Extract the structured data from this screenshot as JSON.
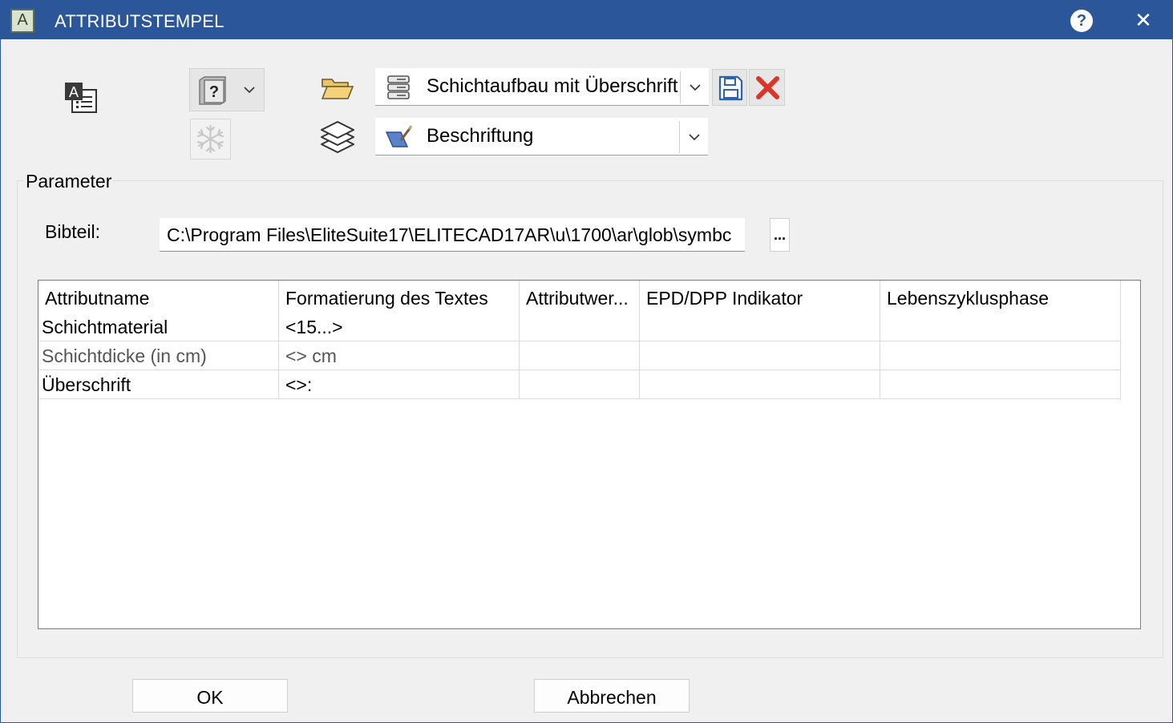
{
  "window": {
    "title": "ATTRIBUTSTEMPEL",
    "app_icon_letter": "A",
    "help_symbol": "?",
    "close_symbol": "✕",
    "titlebar_color": "#2b579a"
  },
  "toolbar": {
    "book_icon_glyph": "?",
    "preset_combo": {
      "value": "Schichtaufbau mit Überschrift"
    },
    "layer_combo": {
      "value": "Beschriftung"
    }
  },
  "parameter": {
    "group_label": "Parameter",
    "bibteil_label": "Bibteil:",
    "bibteil_value": "C:\\Program Files\\EliteSuite17\\ELITECAD17AR\\u\\1700\\ar\\glob\\symbc",
    "browse_label": "..."
  },
  "table": {
    "columns": [
      "Attributname",
      "Formatierung des Textes",
      "Attributwer...",
      "EPD/DPP Indikator",
      "Lebenszyklusphase"
    ],
    "rows": [
      [
        "Schichtmaterial",
        "<15...>",
        "",
        "",
        ""
      ],
      [
        "Schichtdicke (in cm)",
        "<> cm",
        "",
        "",
        ""
      ],
      [
        "Überschrift",
        "<>:",
        "",
        "",
        ""
      ]
    ],
    "selected_row_index": 1
  },
  "buttons": {
    "ok": "OK",
    "cancel": "Abbrechen"
  }
}
